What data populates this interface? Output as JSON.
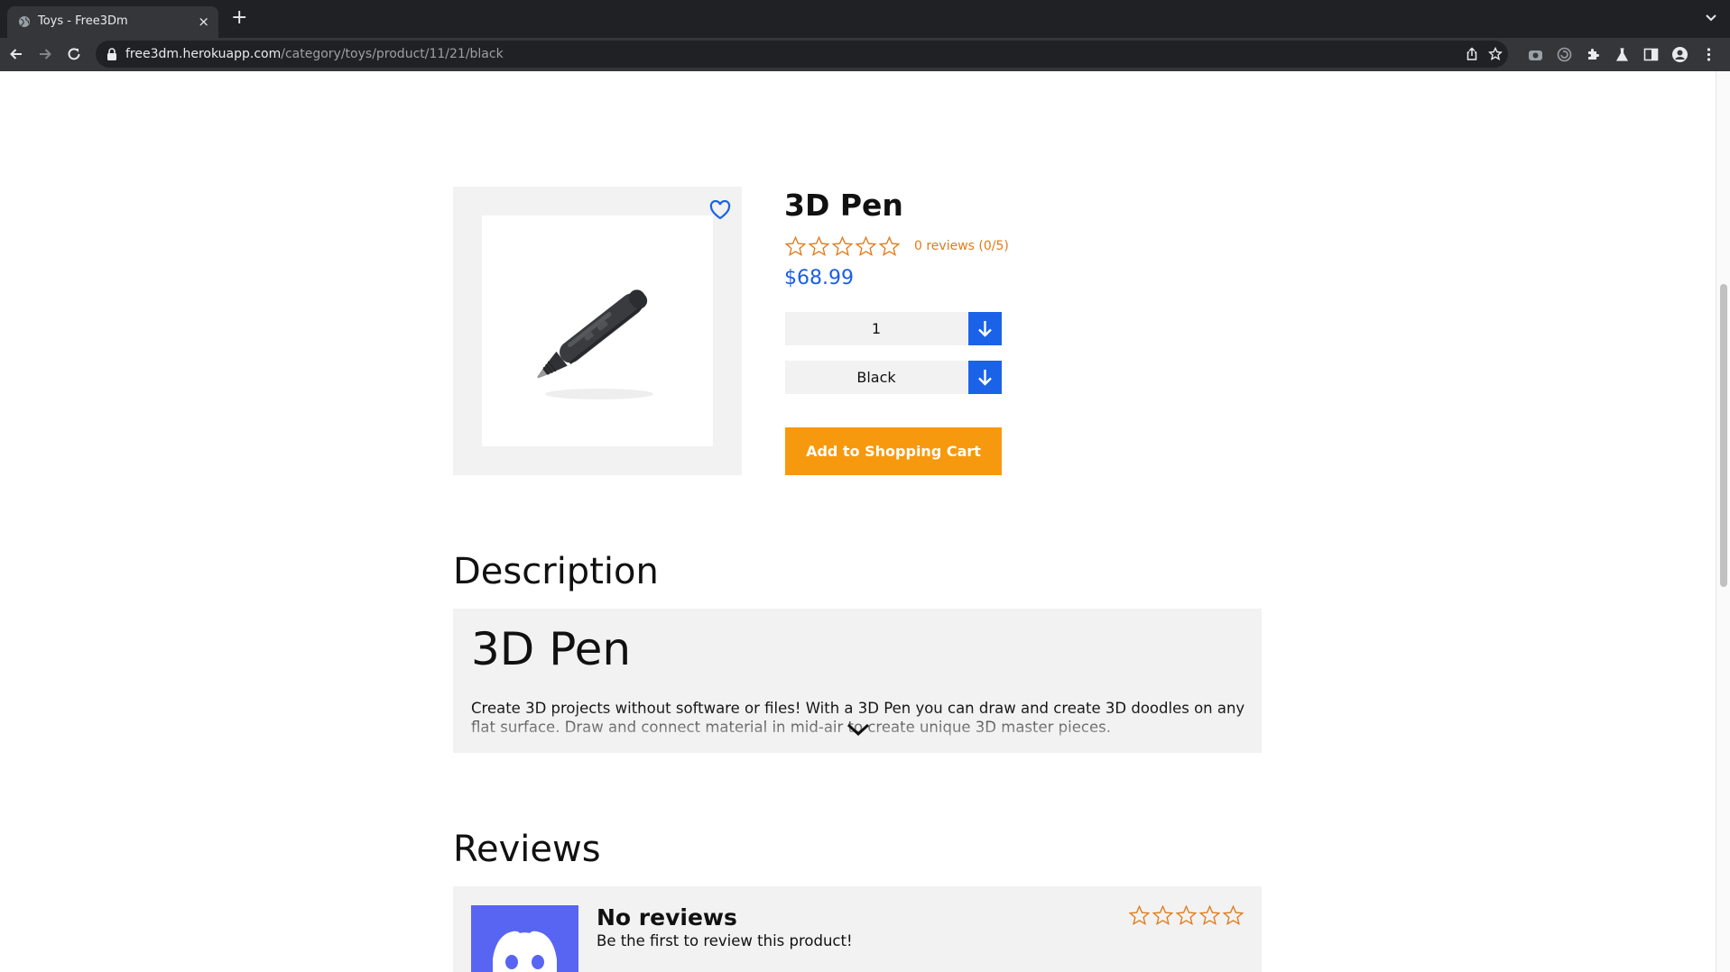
{
  "browser": {
    "tab_title": "Toys - Free3Dm",
    "tab_close": "×",
    "new_tab": "+",
    "url_host": "free3dm.herokuapp.com",
    "url_path": "/category/toys/product/11/21/black"
  },
  "product": {
    "name": "3D Pen",
    "rating_stars": 0,
    "rating_max": 5,
    "reviews_text": "0 reviews (0/5)",
    "price": "$68.99",
    "quantity": "1",
    "color": "Black",
    "add_to_cart_label": "Add to Shopping Cart"
  },
  "description": {
    "section_title": "Description",
    "heading": "3D Pen",
    "text": "Create 3D projects without software or files! With a 3D Pen you can draw and create 3D doodles on any flat surface. Draw and connect material in mid-air to create unique 3D master pieces."
  },
  "reviews": {
    "section_title": "Reviews",
    "empty_title": "No reviews",
    "empty_subtitle": "Be the first to review this product!"
  },
  "colors": {
    "accent_blue": "#1a63e8",
    "orange": "#f7990e",
    "star_orange": "#e07b1a",
    "discord": "#5865f2"
  }
}
